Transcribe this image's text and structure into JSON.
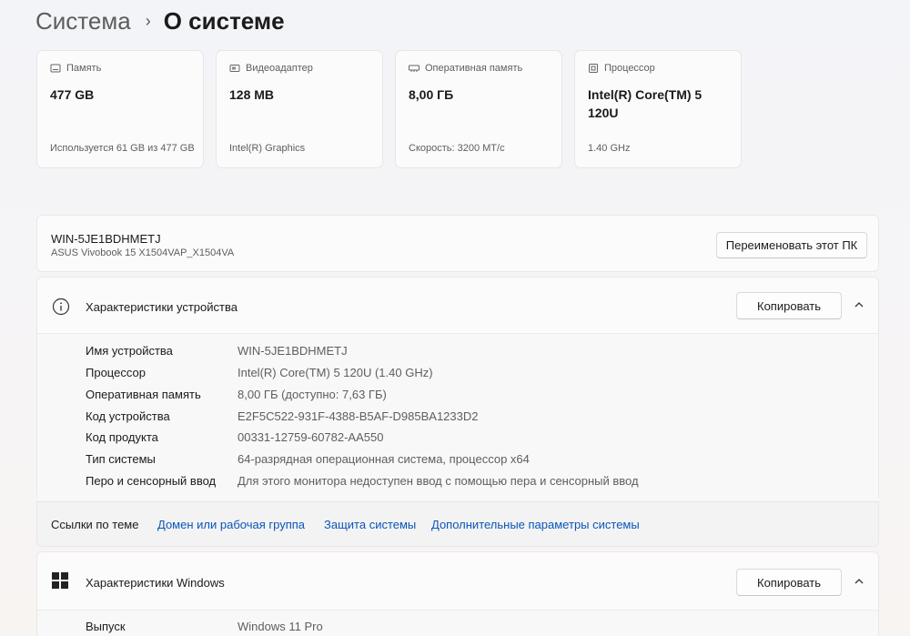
{
  "breadcrumb": {
    "parent": "Система",
    "separator": "›",
    "current": "О системе"
  },
  "cards": [
    {
      "label": "Память",
      "value": "477 GB",
      "sub": "Используется 61 GB из 477 GB",
      "icon": "storage-icon"
    },
    {
      "label": "Видеоадаптер",
      "value": "128 MB",
      "sub": "Intel(R) Graphics",
      "icon": "display-adapter-icon"
    },
    {
      "label": "Оперативная память",
      "value": "8,00 ГБ",
      "sub": "Скорость: 3200 МТ/с",
      "icon": "ram-icon"
    },
    {
      "label": "Процессор",
      "value": "Intel(R) Core(TM) 5 120U",
      "sub": "1.40 GHz",
      "icon": "cpu-icon"
    }
  ],
  "device": {
    "name": "WIN-5JE1BDHMETJ",
    "model": "ASUS Vivobook 15 X1504VAP_X1504VA",
    "rename_label": "Переименовать этот ПК"
  },
  "device_specs": {
    "title": "Характеристики устройства",
    "copy_label": "Копировать",
    "rows": [
      {
        "key": "Имя устройства",
        "value": "WIN-5JE1BDHMETJ"
      },
      {
        "key": "Процессор",
        "value": "Intel(R) Core(TM) 5 120U (1.40 GHz)"
      },
      {
        "key": "Оперативная память",
        "value": "8,00 ГБ (доступно: 7,63 ГБ)"
      },
      {
        "key": "Код устройства",
        "value": "E2F5C522-931F-4388-B5AF-D985BA1233D2"
      },
      {
        "key": "Код продукта",
        "value": "00331-12759-60782-AA550"
      },
      {
        "key": "Тип системы",
        "value": "64-разрядная операционная система, процессор x64"
      },
      {
        "key": "Перо и сенсорный ввод",
        "value": "Для этого монитора недоступен ввод с помощью пера и сенсорный ввод"
      }
    ]
  },
  "related_links": {
    "label": "Ссылки по теме",
    "links": [
      "Домен или рабочая группа",
      "Защита системы",
      "Дополнительные параметры системы"
    ]
  },
  "windows_specs": {
    "title": "Характеристики Windows",
    "copy_label": "Копировать",
    "rows": [
      {
        "key": "Выпуск",
        "value": "Windows 11 Pro"
      }
    ]
  },
  "colors": {
    "link": "#0a56b8",
    "card_bg": "#fbfbfb",
    "text_secondary": "#5e5e5e"
  }
}
